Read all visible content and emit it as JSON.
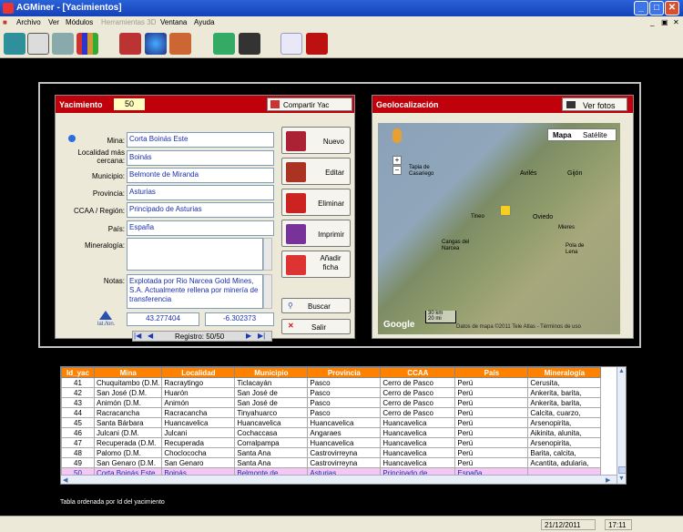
{
  "window": {
    "title": "AGMiner - [Yacimientos]"
  },
  "menu": [
    "Archivo",
    "Ver",
    "Módulos",
    "Herramientas 3D",
    "Ventana",
    "Ayuda"
  ],
  "toolbar_icons": [
    "grid-tool-icon",
    "cube-icon",
    "house-icon",
    "bars-chart-icon",
    "books-icon",
    "globe-icon",
    "catalog-icon",
    "user-group-icon",
    "binoculars-icon",
    "pdf-icon",
    "pdf-red-icon"
  ],
  "yacimiento": {
    "header": "Yacimiento",
    "id": "50",
    "share_label": "Compartir Yac",
    "labels": {
      "mina": "Mina:",
      "localidad": "Localidad más cercana:",
      "municipio": "Municipio:",
      "provincia": "Provincia:",
      "ccaa": "CCAA / Región:",
      "pais": "País:",
      "mineralogia": "Mineralogía:",
      "notas": "Notas:"
    },
    "values": {
      "mina": "Corta Boinás Este",
      "localidad": "Boinás",
      "municipio": "Belmonte de Miranda",
      "provincia": "Asturias",
      "ccaa": "Principado de Asturias",
      "pais": "España",
      "mineralogia": "",
      "notas": "Explotada por Rio Narcea Gold Mines, S.A. Actualmente rellena por minería de transferencia"
    },
    "lat": "43.277404",
    "lon": "-6.302373",
    "latlon_label": "lat./lon.",
    "record": "Registro: 50/50",
    "buttons": {
      "nuevo": "Nuevo",
      "editar": "Editar",
      "eliminar": "Eliminar",
      "imprimir": "Imprimir",
      "anadir": "Añadir ficha",
      "buscar": "Buscar",
      "salir": "Salir"
    }
  },
  "geo": {
    "header": "Geolocalización",
    "photos_label": "Ver fotos",
    "map_tab": "Mapa",
    "sat_tab": "Satélite",
    "places": [
      "Tapia de Casariego",
      "Avilés",
      "Gijón",
      "Oviedo",
      "Tineo",
      "Pola de Lena",
      "Mieres",
      "Cangas del Narcea"
    ],
    "scale_km": "30 km",
    "scale_mi": "20 mi",
    "attribution": "Datos de mapa ©2011 Tele Atlas - Términos de uso",
    "google": "Google"
  },
  "table": {
    "columns": [
      "Id_yac",
      "Mina",
      "Localidad",
      "Municipio",
      "Provincia",
      "CCAA",
      "País",
      "Mineralogía"
    ],
    "rows": [
      [
        "41",
        "Chuquitambo (D.M.",
        "Racraytingo",
        "Ticlacayán",
        "Pasco",
        "Cerro de Pasco",
        "Perú",
        "Cerusita,"
      ],
      [
        "42",
        "San José  (D.M.",
        "Huarón",
        "San José de",
        "Pasco",
        "Cerro de Pasco",
        "Perú",
        "Ankerita, barita,"
      ],
      [
        "43",
        "Animón (D.M.",
        "Animón",
        "San José de",
        "Pasco",
        "Cerro de Pasco",
        "Perú",
        "Ankerita, barita,"
      ],
      [
        "44",
        "Racracancha",
        "Racracancha",
        "Tinyahuarco",
        "Pasco",
        "Cerro de Pasco",
        "Perú",
        "Calcita, cuarzo,"
      ],
      [
        "45",
        "Santa Bárbara",
        "Huancavelica",
        "Huancavelica",
        "Huancavelica",
        "Huancavelica",
        "Perú",
        "Arsenopirita,"
      ],
      [
        "46",
        "Julcani (D.M.",
        "Julcani",
        "Cochaccasa",
        "Angaraes",
        "Huancavelica",
        "Perú",
        "Aikinita, alunita,"
      ],
      [
        "47",
        "Recuperada (D.M.",
        "Recuperada",
        "Corralpampa",
        "Huancavelica",
        "Huancavelica",
        "Perú",
        "Arsenopirita,"
      ],
      [
        "48",
        "Palomo (D.M.",
        "Choclococha",
        "Santa Ana",
        "Castrovirreyna",
        "Huancavelica",
        "Perú",
        "Barita, calcita,"
      ],
      [
        "49",
        "San Genaro (D.M.",
        "San Genaro",
        "Santa Ana",
        "Castrovirreyna",
        "Huancavelica",
        "Perú",
        "Acantita, adularia,"
      ],
      [
        "50",
        "Corta Boinás Este",
        "Boinás",
        "Belmonte de",
        "Asturias",
        "Principado de",
        "España",
        ""
      ]
    ],
    "caption": "Tabla ordenada por Id del yacimiento"
  },
  "status": {
    "date": "21/12/2011",
    "time": "17:11"
  }
}
